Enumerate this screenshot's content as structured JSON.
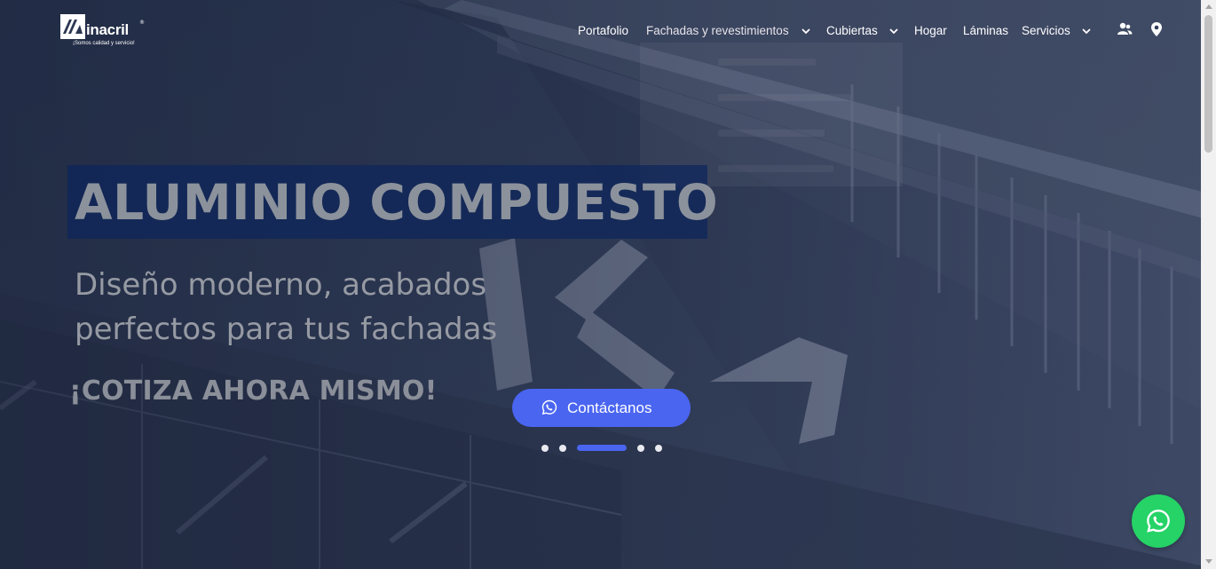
{
  "brand": {
    "name": "inacril",
    "registered": "®",
    "tagline": "¡Somos calidad y servicio!",
    "logo_icon": "inacril-logo-icon"
  },
  "nav": {
    "items": [
      {
        "label": "Portafolio",
        "dropdown": false
      },
      {
        "label": "Fachadas y revestimientos",
        "dropdown": true,
        "active": true
      },
      {
        "label": "Cubiertas",
        "dropdown": true
      },
      {
        "label": "Hogar",
        "dropdown": false
      },
      {
        "label": "Láminas",
        "dropdown": true
      },
      {
        "label": "Servicios",
        "dropdown": true
      }
    ],
    "icons": [
      "users-icon",
      "location-pin-icon"
    ]
  },
  "hero": {
    "headline": "ALUMINIO COMPUESTO",
    "subline": "Diseño moderno, acabados perfectos para tus fachadas",
    "cta_text": "¡COTIZA AHORA MISMO!",
    "button_label": "Contáctanos",
    "button_icon": "whatsapp-icon",
    "slides_total": 5,
    "active_slide": 3
  },
  "floating_button": {
    "icon": "whatsapp-icon"
  },
  "colors": {
    "accent": "#4a65f0",
    "headline_band": "#0d255c",
    "whatsapp": "#25d366"
  }
}
